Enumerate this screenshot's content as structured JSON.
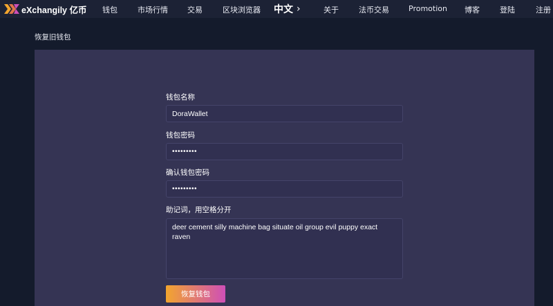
{
  "header": {
    "logo_text": "eXchangily 亿币",
    "nav": [
      {
        "label": "钱包"
      },
      {
        "label": "市场行情"
      },
      {
        "label": "交易"
      },
      {
        "label": "区块浏览器"
      },
      {
        "label": "关于"
      },
      {
        "label": "法币交易"
      },
      {
        "label": "Promotion"
      },
      {
        "label": "博客"
      },
      {
        "label": "登陆"
      },
      {
        "label": "注册"
      }
    ],
    "language": "中文",
    "language_icon": "chevron-right-icon"
  },
  "page": {
    "title": "恢复旧钱包"
  },
  "form": {
    "wallet_name_label": "钱包名称",
    "wallet_name_value": "DoraWallet",
    "password_label": "钱包密码",
    "password_value": "•••••••••",
    "confirm_password_label": "确认钱包密码",
    "confirm_password_value": "•••••••••",
    "mnemonic_label": "助记词，用空格分开",
    "mnemonic_value": "deer cement silly machine bag situate oil group evil puppy exact raven",
    "submit_label": "恢复钱包"
  },
  "colors": {
    "topbar_bg": "#1c2235",
    "page_bg": "#141b2c",
    "card_bg": "#353454",
    "button_gradient_start": "#f2a52e",
    "button_gradient_end": "#cf4fb7"
  }
}
